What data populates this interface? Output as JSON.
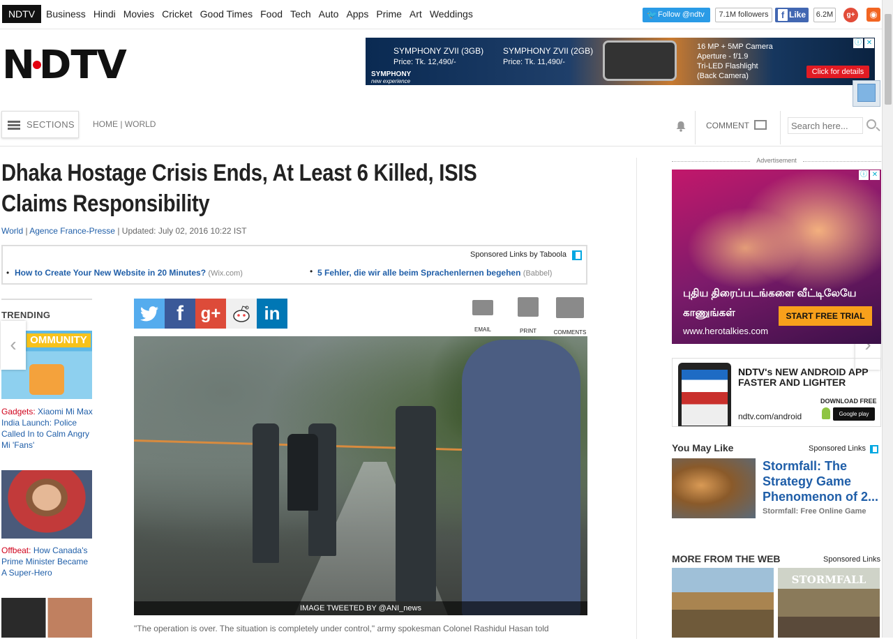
{
  "topnav": {
    "brand": "NDTV",
    "items": [
      "Business",
      "Hindi",
      "Movies",
      "Cricket",
      "Good Times",
      "Food",
      "Tech",
      "Auto",
      "Apps",
      "Prime",
      "Art",
      "Weddings"
    ],
    "twitter_label": "Follow @ndtv",
    "twitter_count": "7.1M followers",
    "facebook_label": "Like",
    "facebook_count": "6.2M"
  },
  "logo": {
    "text_left": "N",
    "text_right": "DTV"
  },
  "top_ad": {
    "model1": "SYMPHONY ZVII (3GB)",
    "price1": "Price: Tk. 12,490/-",
    "model2": "SYMPHONY ZVII (2GB)",
    "price2": "Price: Tk. 11,490/-",
    "brand": "SYMPHONY",
    "tagline": "new experience",
    "spec1": "16 MP + 5MP Camera",
    "spec2": "Aperture - f/1.9",
    "spec3": "Tri-LED Flashlight",
    "spec4": "(Back Camera)",
    "cta": "Click for details"
  },
  "sections_bar": {
    "sections_label": "SECTIONS",
    "breadcrumb": "HOME | WORLD",
    "comment_label": "COMMENT",
    "search_placeholder": "Search here..."
  },
  "article": {
    "headline": "Dhaka Hostage Crisis Ends, At Least 6 Killed, ISIS Claims Responsibility",
    "category": "World",
    "source": "Agence France-Presse",
    "updated": "| Updated: July 02, 2016 10:22 IST",
    "image_caption": "IMAGE TWEETED BY @ANI_news",
    "first_para": "\"The operation is over. The situation is completely under control,\" army spokesman Colonel Rashidul Hasan told"
  },
  "taboola": {
    "header": "Sponsored Links by Taboola",
    "links": [
      {
        "title": "How to Create Your New Website in 20 Minutes?",
        "source": "(Wix.com)"
      },
      {
        "title": "5 Fehler, die wir alle beim Sprachenlernen begehen",
        "source": "(Babbel)"
      }
    ]
  },
  "share": {
    "buttons": [
      "twitter",
      "facebook",
      "google-plus",
      "reddit",
      "linkedin"
    ],
    "facebook_glyph": "f",
    "googleplus_glyph": "g+",
    "linkedin_glyph": "in",
    "tools": [
      "EMAIL",
      "PRINT",
      "COMMENTS"
    ]
  },
  "trending": {
    "title": "TRENDING",
    "items": [
      {
        "category": "Gadgets:",
        "title": "Xiaomi Mi Max India Launch: Police Called In to Calm Angry Mi 'Fans'",
        "image_text": "OMMUNITY"
      },
      {
        "category": "Offbeat:",
        "title": "How Canada's Prime Minister Became A Super-Hero"
      }
    ]
  },
  "right_ad": {
    "label": "Advertisement",
    "tamil_line1": "புதிய திரைப்படங்களை வீட்டிலேயே",
    "tamil_line2": "காணுங்கள்",
    "cta": "START FREE TRIAL",
    "site": "www.herotalkies.com"
  },
  "android_ad": {
    "brand": "NDTV",
    "headline": "'s NEW ANDROID APP FASTER AND LIGHTER",
    "url": "ndtv.com/android",
    "download": "DOWNLOAD FREE",
    "store": "Google play"
  },
  "you_may_like": {
    "title": "You May Like",
    "sponsored": "Sponsored Links",
    "item_title": "Stormfall: The Strategy Game Phenomenon of 2...",
    "item_source": "Stormfall: Free Online Game"
  },
  "more_from_web": {
    "title": "MORE FROM THE WEB",
    "sponsored": "Sponsored Links",
    "tile2_text": "STORMFALL"
  },
  "colors": {
    "accent": "#e4000f",
    "link": "#1f5ea8",
    "twitter": "#55acee",
    "facebook": "#3b5998",
    "googleplus": "#dd4b39",
    "linkedin": "#0077b5"
  }
}
